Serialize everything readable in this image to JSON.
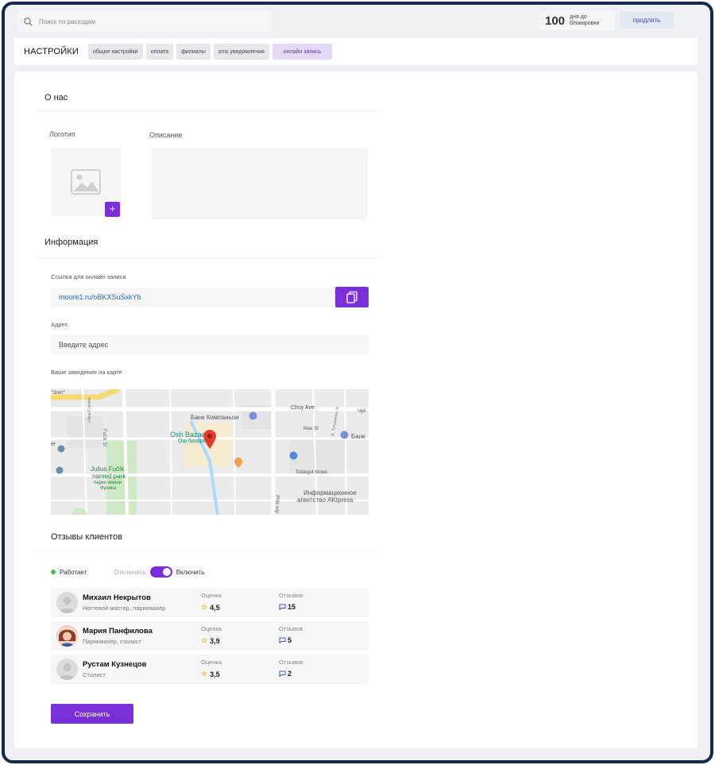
{
  "header": {
    "search_placeholder": "Поиск по расходам",
    "days_number": "100",
    "days_label_line1": "дня до",
    "days_label_line2": "блокировки",
    "extend_label": "продлить"
  },
  "settings": {
    "title": "НАСТРОЙКИ",
    "tabs": [
      {
        "label": "общие настройки"
      },
      {
        "label": "оплата"
      },
      {
        "label": "филиалы"
      },
      {
        "label": "sms уведомления"
      },
      {
        "label": "онлайн запись"
      }
    ],
    "active_tab": "онлайн запись"
  },
  "about": {
    "title": "О нас",
    "logo_label": "Логотип",
    "description_label": "Описание",
    "description_value": ""
  },
  "info": {
    "title": "Информация",
    "link_label": "Ссылка для онлайн записи",
    "link_value": "moore1.ru/oBKXSuSxkYb",
    "address_label": "Адрес",
    "address_placeholder": "Введите адрес",
    "map_label": "Ваше заведение на карте"
  },
  "map": {
    "labels": {
      "elit": "\"Элит\"",
      "bank": "Банк Компаньон",
      "chuy": "Chuy Ave",
      "osh": "Osh Bazaar",
      "osh_ru": "Ош базары",
      "kiev": "Kiev St",
      "bank2": "Банк",
      "toktogul": "Toktogul Street",
      "julius1": "Julius Fučík",
      "julius2": "named park",
      "julius_ru1": "парки имени",
      "julius_ru2": "Фучика",
      "info1": "Информационное",
      "info2": "агентство AKIpress",
      "fucik": "Fučík St",
      "ulitsa": "Ulitsa Fuchika",
      "tm": "K. Tynystanov St",
      "dye": "dye Blvd",
      "er": "er",
      "chu": "Чуй"
    }
  },
  "reviews": {
    "title": "Отзывы клиентов",
    "status": "Работает",
    "off_label": "Отключить",
    "on_label": "Включить",
    "items": [
      {
        "name": "Михаил Некрытов",
        "role": "Ногтевой мастер, парикмахер",
        "rating_label": "Оценка",
        "rating": "4,5",
        "count_label": "Отзывов",
        "count": "15"
      },
      {
        "name": "Мария Панфилова",
        "role": "Парикмахер, стилист",
        "rating_label": "Оценка",
        "rating": "3,9",
        "count_label": "Отзывов",
        "count": "5"
      },
      {
        "name": "Рустам Кузнецов",
        "role": "Стилист",
        "rating_label": "Оценка",
        "rating": "3,5",
        "count_label": "Отзывов",
        "count": "2"
      }
    ]
  },
  "save_label": "Сохранить",
  "colors": {
    "accent": "#7b2fd8",
    "frame": "#15294b",
    "link": "#2a67c4",
    "status_on": "#3cc33c"
  }
}
